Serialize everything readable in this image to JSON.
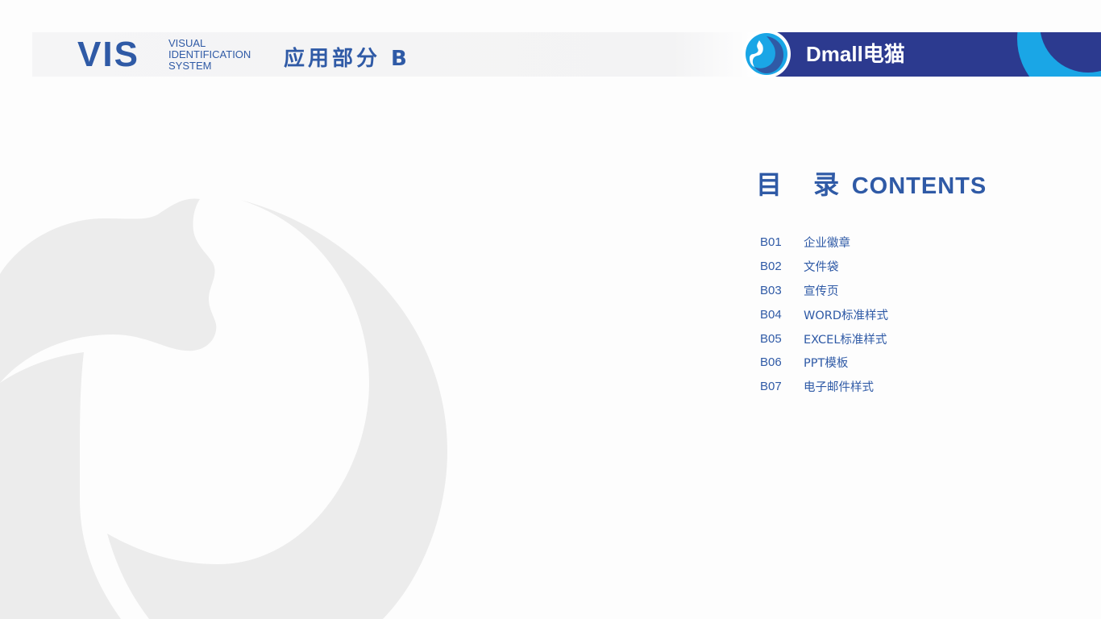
{
  "header": {
    "vis_title": "VIS",
    "vis_subtitle_lines": [
      "VISUAL",
      "IDENTIFICATION",
      "SYSTEM"
    ],
    "section_title": "应用部分  B"
  },
  "brand": {
    "name": "Dmall电猫",
    "colors": {
      "primary_blue": "#2f5aa6",
      "band_navy": "#2c3a8f",
      "accent_cyan": "#1aa6e6"
    },
    "emblem_icon": "dmall-cat-emblem-icon"
  },
  "contents": {
    "heading_zh": "目 录",
    "heading_en": "CONTENTS",
    "items": [
      {
        "code": "B01",
        "label": "企业徽章"
      },
      {
        "code": "B02",
        "label": "文件袋"
      },
      {
        "code": "B03",
        "label": "宣传页"
      },
      {
        "code": "B04",
        "label": "WORD标准样式"
      },
      {
        "code": "B05",
        "label": "EXCEL标准样式"
      },
      {
        "code": "B06",
        "label": "PPT模板"
      },
      {
        "code": "B07",
        "label": "电子邮件样式"
      }
    ]
  },
  "background": {
    "watermark_icon": "cat-circle-watermark-icon",
    "watermark_color": "#ececec"
  }
}
